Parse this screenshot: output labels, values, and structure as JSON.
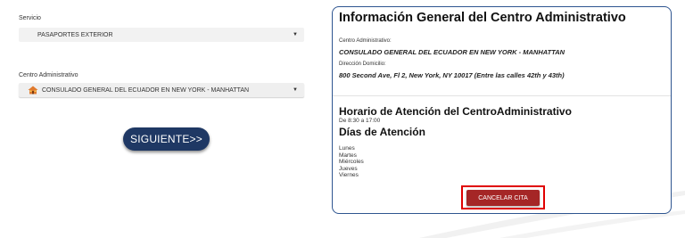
{
  "form": {
    "servicio_label": "Servicio",
    "servicio_value": "PASAPORTES EXTERIOR",
    "centro_label": "Centro Administrativo",
    "centro_value": "CONSULADO GENERAL DEL ECUADOR EN NEW YORK - MANHATTAN",
    "caret": "▼",
    "siguiente_label": "SIGUIENTE>>"
  },
  "info": {
    "title": "Información General del Centro Administrativo",
    "centro_label": "Centro Administrativo:",
    "centro_value": "CONSULADO GENERAL DEL ECUADOR EN NEW YORK - MANHATTAN",
    "direccion_label": "Dirección Domicilio:",
    "direccion_value": "800 Second Ave, Fl 2, New York, NY 10017 (Entre las calles 42th y 43th)",
    "horario_title": "Horario de Atención del CentroAdministrativo",
    "horario_value": "De 8:30 a 17:00",
    "dias_title": "Días de Atención",
    "dias": [
      "Lunes",
      "Martes",
      "Miércoles",
      "Jueves",
      "Viernes"
    ],
    "cancelar_label": "CANCELAR CITA"
  },
  "colors": {
    "siguiente_bg": "#1f3864",
    "cancelar_bg": "#a52626",
    "highlight": "#e00000",
    "card_border": "#2e5590"
  }
}
